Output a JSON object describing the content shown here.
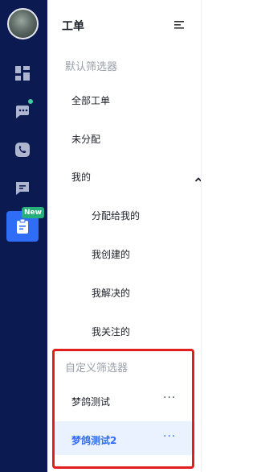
{
  "sidebar": {
    "new_badge": "New",
    "icons": [
      "avatar",
      "dashboard-icon",
      "chat-icon",
      "phone-icon",
      "message-icon",
      "ticket-icon"
    ]
  },
  "panel": {
    "title": "工单",
    "default_section": "默认筛选器",
    "items": [
      "全部工单",
      "未分配",
      "我的"
    ],
    "mine_sub": [
      "分配给我的",
      "我创建的",
      "我解决的",
      "我关注的"
    ],
    "custom_section": "自定义筛选器",
    "custom_items": [
      "梦鸽测试",
      "梦鸽测试2"
    ],
    "more": "···"
  },
  "colors": {
    "rail": "#0c1a52",
    "accent": "#2f6df6",
    "badge_green": "#26b079",
    "highlight": "#e11d1d"
  }
}
